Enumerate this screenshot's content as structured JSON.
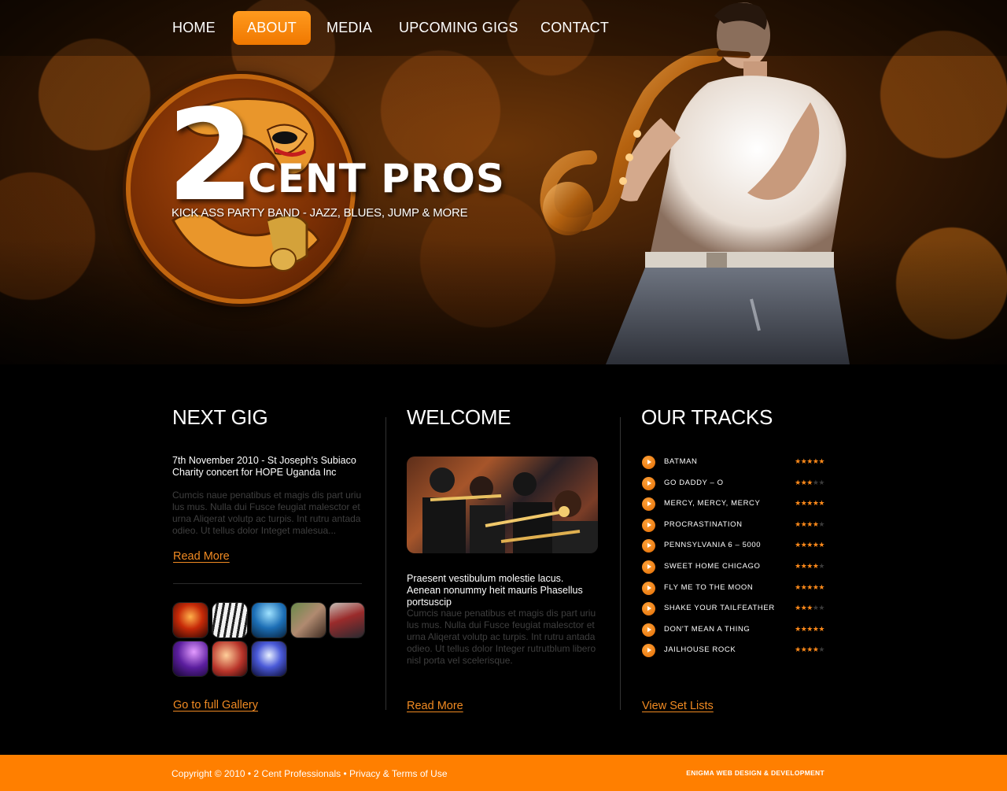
{
  "nav": {
    "items": [
      {
        "label": "HOME"
      },
      {
        "label": "ABOUT",
        "active": true
      },
      {
        "label": "MEDIA"
      },
      {
        "label": "UPCOMING GIGS"
      },
      {
        "label": "CONTACT"
      }
    ]
  },
  "logo": {
    "numeral": "2",
    "name": "CENT PROS",
    "tagline": "KICK ASS PARTY BAND - JAZZ, BLUES, JUMP & MORE"
  },
  "next_gig": {
    "title": "NEXT GIG",
    "lead": "7th November 2010 - St Joseph's Subiaco Charity concert for HOPE Uganda Inc",
    "body": "Cumcis naue penatibus et magis dis part uriu lus mus. Nulla dui Fusce feugiat malesctor et urna Aliqerat volutp ac turpis. Int rutru antada odieo. Ut tellus dolor Integet malesua...",
    "read_more": "Read More",
    "gallery_link": "Go to full Gallery",
    "thumbnails": [
      "concert-lights",
      "piano-keys",
      "stage-crowd",
      "band-party",
      "singer-suit",
      "purple-stage",
      "dance-party",
      "blue-lights"
    ]
  },
  "welcome": {
    "title": "WELCOME",
    "lead": "Praesent vestibulum molestie lacus. Aenean nonummy heit mauris Phasellus portsuscip",
    "body": "Cumcis naue penatibus et magis dis part uriu lus mus. Nulla dui Fusce feugiat malesctor et urna Aliqerat volutp ac turpis. Int rutru antada odieo. Ut tellus dolor Integer rutrutblum libero nisl porta vel scelerisque.",
    "read_more": "Read More"
  },
  "tracks": {
    "title": "OUR TRACKS",
    "items": [
      {
        "name": "BATMAN",
        "rating": 5
      },
      {
        "name": "GO DADDY – O",
        "rating": 3
      },
      {
        "name": "MERCY, MERCY, MERCY",
        "rating": 5
      },
      {
        "name": "PROCRASTINATION",
        "rating": 4
      },
      {
        "name": "PENNSYLVANIA 6 – 5000",
        "rating": 5
      },
      {
        "name": "SWEET HOME CHICAGO",
        "rating": 4
      },
      {
        "name": "FLY ME TO THE MOON",
        "rating": 5
      },
      {
        "name": "SHAKE YOUR TAILFEATHER",
        "rating": 3
      },
      {
        "name": "DON'T MEAN A THING",
        "rating": 5
      },
      {
        "name": "JAILHOUSE ROCK",
        "rating": 4
      }
    ],
    "max_rating": 5,
    "set_lists_link": "View Set Lists"
  },
  "footer": {
    "copyright_prefix": "Copyright © 2010 • 2 Cent Professionals •",
    "privacy_link": "Privacy & Terms of Use",
    "credit": "ENIGMA WEB DESIGN & DEVELOPMENT"
  },
  "colors": {
    "accent": "#ff7f00",
    "link": "#f08a22",
    "background": "#000000"
  }
}
